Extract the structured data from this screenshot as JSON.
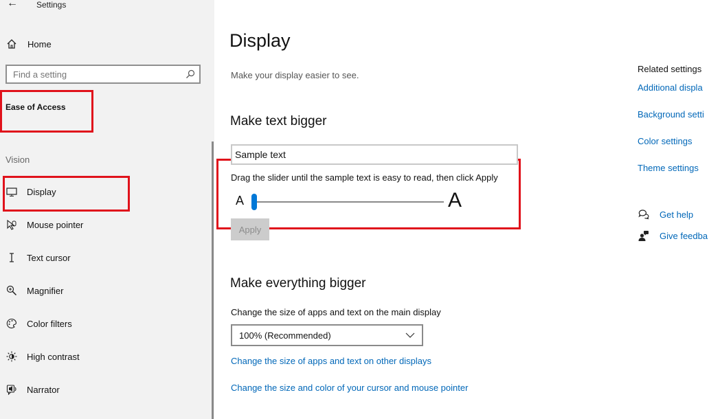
{
  "window": {
    "title": "Settings",
    "back_icon": "back-arrow-icon"
  },
  "sidebar": {
    "home_label": "Home",
    "search_placeholder": "Find a setting",
    "section_title": "Ease of Access",
    "group_label": "Vision",
    "items": [
      {
        "label": "Display",
        "icon": "monitor-icon"
      },
      {
        "label": "Mouse pointer",
        "icon": "mouse-pointer-icon"
      },
      {
        "label": "Text cursor",
        "icon": "text-cursor-icon"
      },
      {
        "label": "Magnifier",
        "icon": "magnifier-icon"
      },
      {
        "label": "Color filters",
        "icon": "color-filters-icon"
      },
      {
        "label": "High contrast",
        "icon": "high-contrast-icon"
      },
      {
        "label": "Narrator",
        "icon": "narrator-icon"
      }
    ]
  },
  "main": {
    "title": "Display",
    "subtitle": "Make your display easier to see.",
    "text_bigger": {
      "heading": "Make text bigger",
      "sample_text": "Sample text",
      "instruction": "Drag the slider until the sample text is easy to read, then click Apply",
      "small_a": "A",
      "big_a": "A",
      "slider_value": 0,
      "apply_label": "Apply"
    },
    "everything_bigger": {
      "heading": "Make everything bigger",
      "description": "Change the size of apps and text on the main display",
      "scale_value": "100% (Recommended)",
      "link_other_displays": "Change the size of apps and text on other displays",
      "link_cursor": "Change the size and color of your cursor and mouse pointer"
    }
  },
  "related": {
    "title": "Related settings",
    "links": [
      "Additional displa",
      "Background setti",
      "Color settings",
      "Theme settings"
    ],
    "get_help": "Get help",
    "give_feedback": "Give feedba"
  },
  "colors": {
    "accent": "#0078d7",
    "link": "#0067b8",
    "highlight_box": "#e0121b",
    "sidebar_bg": "#f2f2f2"
  }
}
